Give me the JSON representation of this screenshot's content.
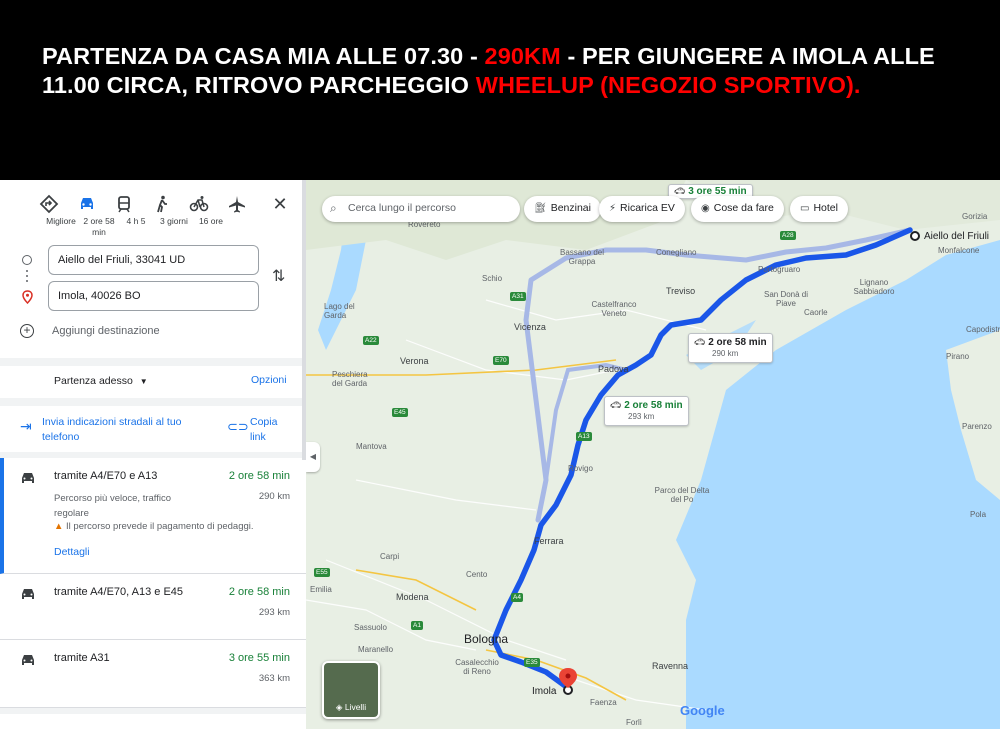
{
  "banner": {
    "part1": "PARTENZA DA CASA MIA ALLE 07.30 - ",
    "km": "290KM",
    "part2": " - PER GIUNGERE A IMOLA ALLE 11.00 CIRCA, RITROVO PARCHEGGIO ",
    "shop": "WHEELUP (NEGOZIO SPORTIVO)."
  },
  "modes": [
    {
      "icon": "diamond-turn-icon",
      "label": "Migliore"
    },
    {
      "icon": "car-icon",
      "label": "2 ore 58 min"
    },
    {
      "icon": "train-icon",
      "label": "4 h 5"
    },
    {
      "icon": "walk-icon",
      "label": "3 giorni"
    },
    {
      "icon": "bike-icon",
      "label": "16 ore"
    },
    {
      "icon": "plane-icon",
      "label": ""
    }
  ],
  "origin": "Aiello del Friuli, 33041 UD",
  "destination": "Imola, 40026 BO",
  "add_destination": "Aggiungi destinazione",
  "departure": "Partenza adesso",
  "options": "Opzioni",
  "send_directions": "Invia indicazioni stradali al tuo telefono",
  "copy_link": "Copia link",
  "routes": [
    {
      "name": "tramite A4/E70 e A13",
      "time": "2 ore 58 min",
      "km": "290 km",
      "desc": "Percorso più veloce, traffico regolare",
      "warning": "Il percorso prevede il pagamento di pedaggi.",
      "details": "Dettagli"
    },
    {
      "name": "tramite A4/E70, A13 e E45",
      "time": "2 ore 58 min",
      "km": "293 km"
    },
    {
      "name": "tramite A31",
      "time": "3 ore 55 min",
      "km": "363 km"
    }
  ],
  "map": {
    "search_placeholder": "Cerca lungo il percorso",
    "chips": [
      "Benzinai",
      "Ricarica EV",
      "Cose da fare",
      "Hotel"
    ],
    "route_boxes": [
      {
        "time": "2 ore 58 min",
        "km": "290 km"
      },
      {
        "time": "2 ore 58 min",
        "km": "293 km"
      },
      {
        "time": "3 ore 55 min"
      }
    ],
    "start_label": "Aiello del Friuli",
    "end_label": "Imola",
    "big_cities": [
      "Bologna",
      "Padova",
      "Treviso",
      "Vicenza",
      "Verona",
      "Ferrara"
    ],
    "towns": [
      "Rovereto",
      "Bassano del Grappa",
      "Conegliano",
      "Schio",
      "Castelfranco Veneto",
      "Portogruaro",
      "San Donà di Piave",
      "Lignano Sabbiadoro",
      "Caorle",
      "Mantova",
      "Rovigo",
      "Parco del Delta del Po",
      "Carpi",
      "Modena",
      "Cento",
      "Emilia",
      "Sassuolo",
      "Maranello",
      "Casalecchio di Reno",
      "Ravenna",
      "Faenza",
      "Forlì",
      "Lago del Garda",
      "Peschiera del Garda",
      "Gorizia",
      "Monfalcone",
      "Capodistria",
      "Pirano",
      "Parenzo",
      "Pola"
    ],
    "highways": [
      "A31",
      "A22",
      "E45",
      "A13",
      "E70",
      "A4",
      "E55",
      "A28",
      "A1",
      "E35"
    ],
    "layers": "Livelli",
    "logo": "Google"
  },
  "colors": {
    "route": "#1a56e8",
    "alt_route": "#a7b8e6",
    "water": "#aadaff",
    "land": "#e8efe4"
  }
}
